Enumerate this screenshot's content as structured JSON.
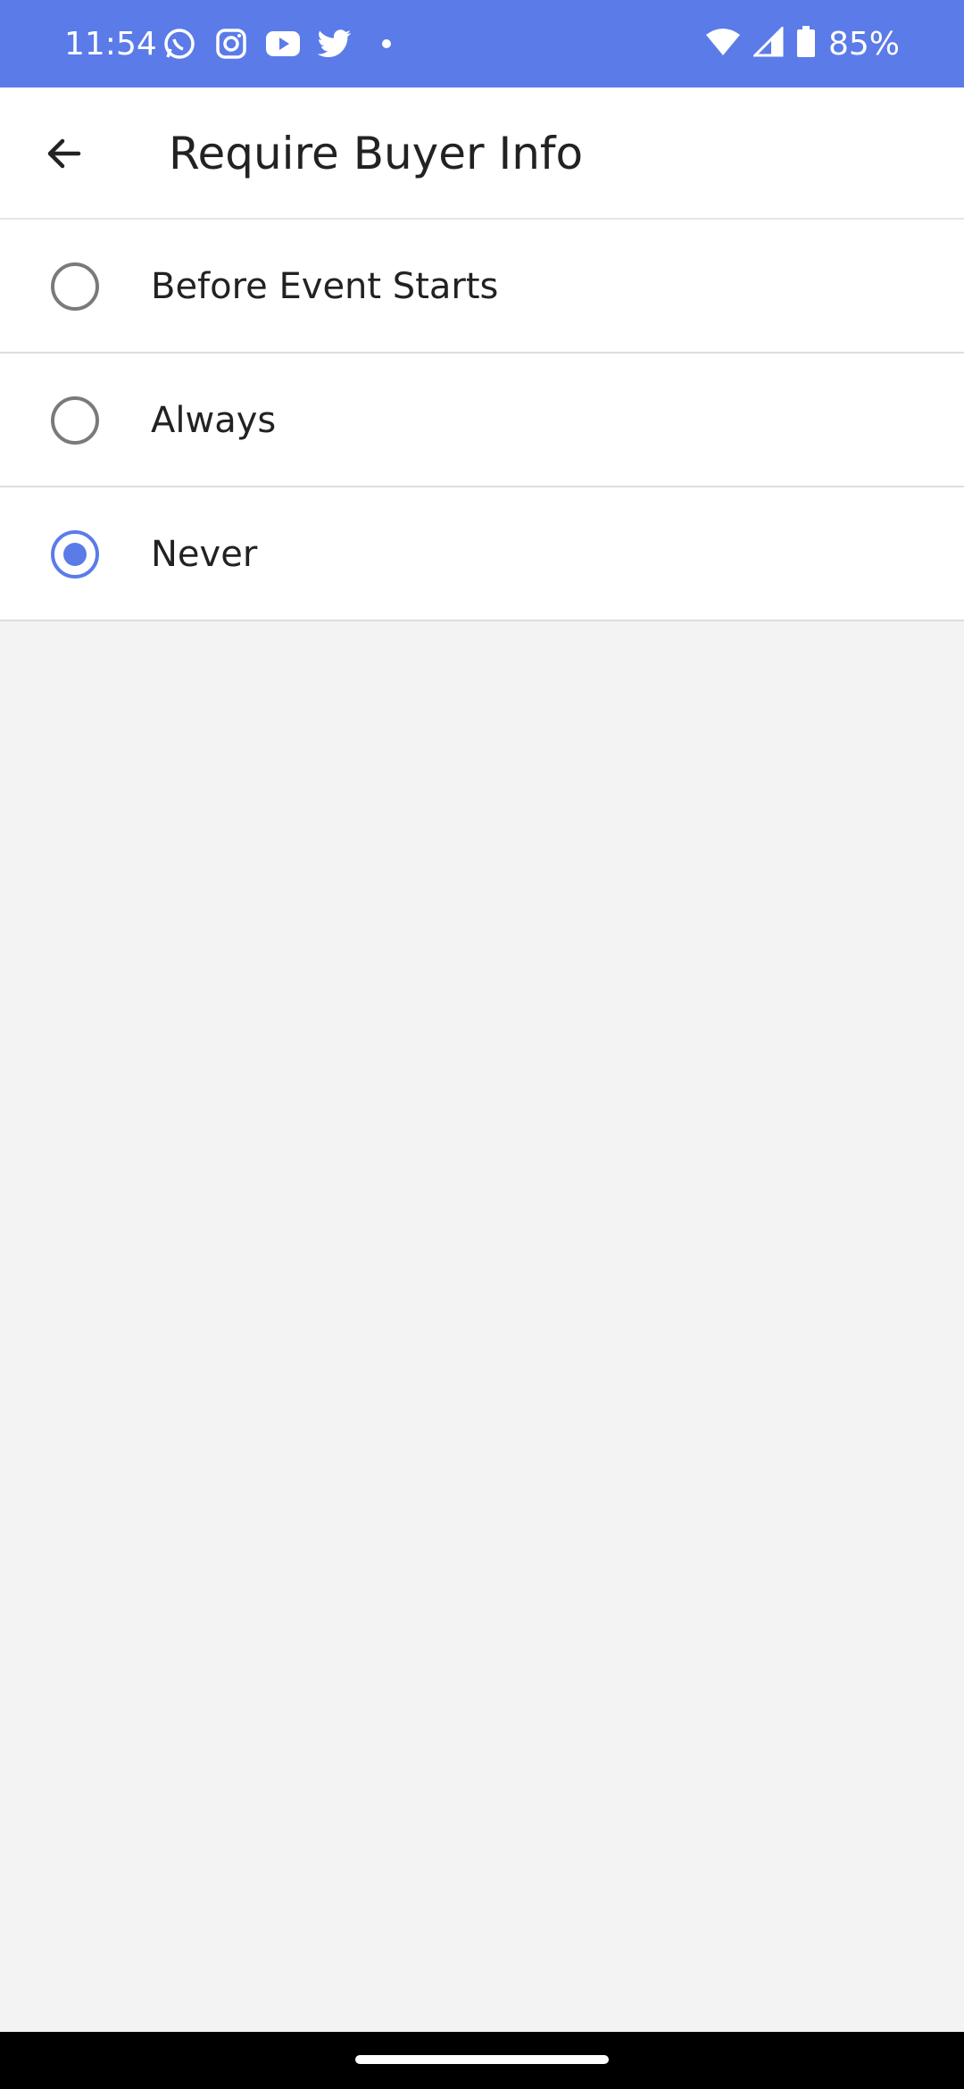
{
  "status_bar": {
    "time": "11:54",
    "left_icons": [
      "whatsapp-icon",
      "instagram-icon",
      "youtube-icon",
      "twitter-icon",
      "dot-icon"
    ],
    "right_icons": [
      "wifi-icon",
      "signal-icon",
      "battery-icon"
    ],
    "battery": "85%",
    "background": "#5b7be8"
  },
  "header": {
    "title": "Require Buyer Info",
    "back_icon": "arrow-left-icon"
  },
  "options": [
    {
      "label": "Before Event Starts",
      "selected": false
    },
    {
      "label": "Always",
      "selected": false
    },
    {
      "label": "Never",
      "selected": true
    }
  ],
  "colors": {
    "accent": "#5b7be8",
    "radio_unselected": "#7a7a7a",
    "background": "#f3f3f3"
  }
}
